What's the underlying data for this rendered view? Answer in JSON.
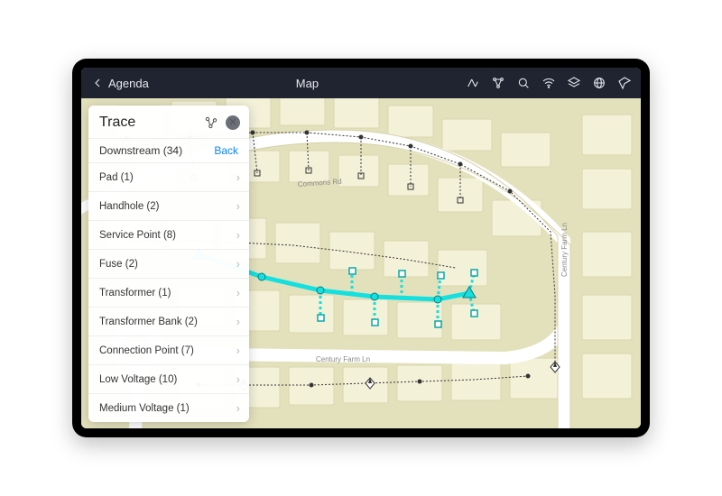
{
  "topbar": {
    "back_label": "Agenda",
    "title": "Map",
    "tools": [
      {
        "name": "trace-tool-icon"
      },
      {
        "name": "network-icon"
      },
      {
        "name": "search-icon"
      },
      {
        "name": "wifi-icon"
      },
      {
        "name": "layers-icon"
      },
      {
        "name": "globe-icon"
      },
      {
        "name": "locate-icon"
      }
    ]
  },
  "panel": {
    "title": "Trace",
    "mode": "Downstream",
    "mode_count": 34,
    "back_label": "Back",
    "items": [
      {
        "label": "Pad",
        "count": 1
      },
      {
        "label": "Handhole",
        "count": 2
      },
      {
        "label": "Service Point",
        "count": 8
      },
      {
        "label": "Fuse",
        "count": 2
      },
      {
        "label": "Transformer",
        "count": 1
      },
      {
        "label": "Transformer Bank",
        "count": 2
      },
      {
        "label": "Connection Point",
        "count": 7
      },
      {
        "label": "Low Voltage",
        "count": 10
      },
      {
        "label": "Medium Voltage",
        "count": 1
      }
    ]
  },
  "map": {
    "roads": [
      {
        "name": "Commons Rd"
      },
      {
        "name": "Century Farm Ln"
      }
    ],
    "trace_color": "#14e0e0",
    "base_color": "#e8e6c5",
    "parcel_color": "#f3f1d8",
    "road_color": "#ffffff"
  }
}
